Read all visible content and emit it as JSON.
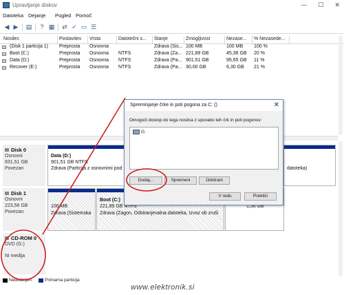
{
  "window": {
    "title": "Upravljanje diskov"
  },
  "menu": [
    "Datoteka",
    "Dejanje",
    "Pogled",
    "Pomoč"
  ],
  "table": {
    "headers": [
      "Nosilec",
      "Postavitev",
      "Vrsta",
      "Datotečni s...",
      "Stanje",
      "Zmogljivost",
      "Nezase...",
      "% Nezasede..."
    ],
    "rows": [
      [
        "(Disk 1 particija 1)",
        "Preprosta",
        "Osnovna",
        "",
        "Zdrava (Sis...",
        "100 MB",
        "100 MB",
        "100 %"
      ],
      [
        "Boot (C:)",
        "Preprosta",
        "Osnovna",
        "NTFS",
        "Zdrava (Za...",
        "221,89 GB",
        "45,36 GB",
        "20 %"
      ],
      [
        "Data (D:)",
        "Preprosta",
        "Osnovna",
        "NTFS",
        "Zdrava (Pa...",
        "901,51 GB",
        "95,65 GB",
        "11 %"
      ],
      [
        "Recover (E:)",
        "Preprosta",
        "Osnovna",
        "NTFS",
        "Zdrava (Pa...",
        "30,00 GB",
        "6,30 GB",
        "21 %"
      ]
    ]
  },
  "disks": {
    "disk0": {
      "name": "Disk 0",
      "type": "Osnovni",
      "size": "931,51 GB",
      "status": "Povezan",
      "part_title": "Data  (D:)",
      "part_size": "901,51 GB NTFS",
      "part_status": "Zdrava (Particija z osnovnimi pod",
      "right_part_status": "datoteka)"
    },
    "disk1": {
      "name": "Disk 1",
      "type": "Osnovni",
      "size": "223,56 GB",
      "status": "Povezan",
      "p1_size": "100 MB",
      "p1_status": "Zdrava (Sistemska",
      "p2_title": "Boot  (C:)",
      "p2_size": "221,89 GB NTFS",
      "p2_status": "Zdrava (Zagon, Odstranjevalna datoteka, Izvoz ob zruši",
      "p3_size": "1,56 GB"
    },
    "cdrom": {
      "name": "CD-ROM 0",
      "drive": "DVD (G:)",
      "media": "Ni medija"
    }
  },
  "legend": {
    "unallocated": "Nedodeljen",
    "primary": "Primarna particija"
  },
  "dialog": {
    "title": "Spreminjanje črke in poti pogona za C: ()",
    "message": "Omogoči dostop do tega nosilca z uporabo teh črk in poti pogonov:",
    "list_item": "G:",
    "add": "Dodaj...",
    "change": "Spremeni",
    "remove": "Odstrani",
    "ok": "V redu",
    "cancel": "Prekliči"
  },
  "watermark": "www.elektronik.si",
  "colors": {
    "primary_partition": "#0a2a8c",
    "annotation": "#c8201f"
  }
}
